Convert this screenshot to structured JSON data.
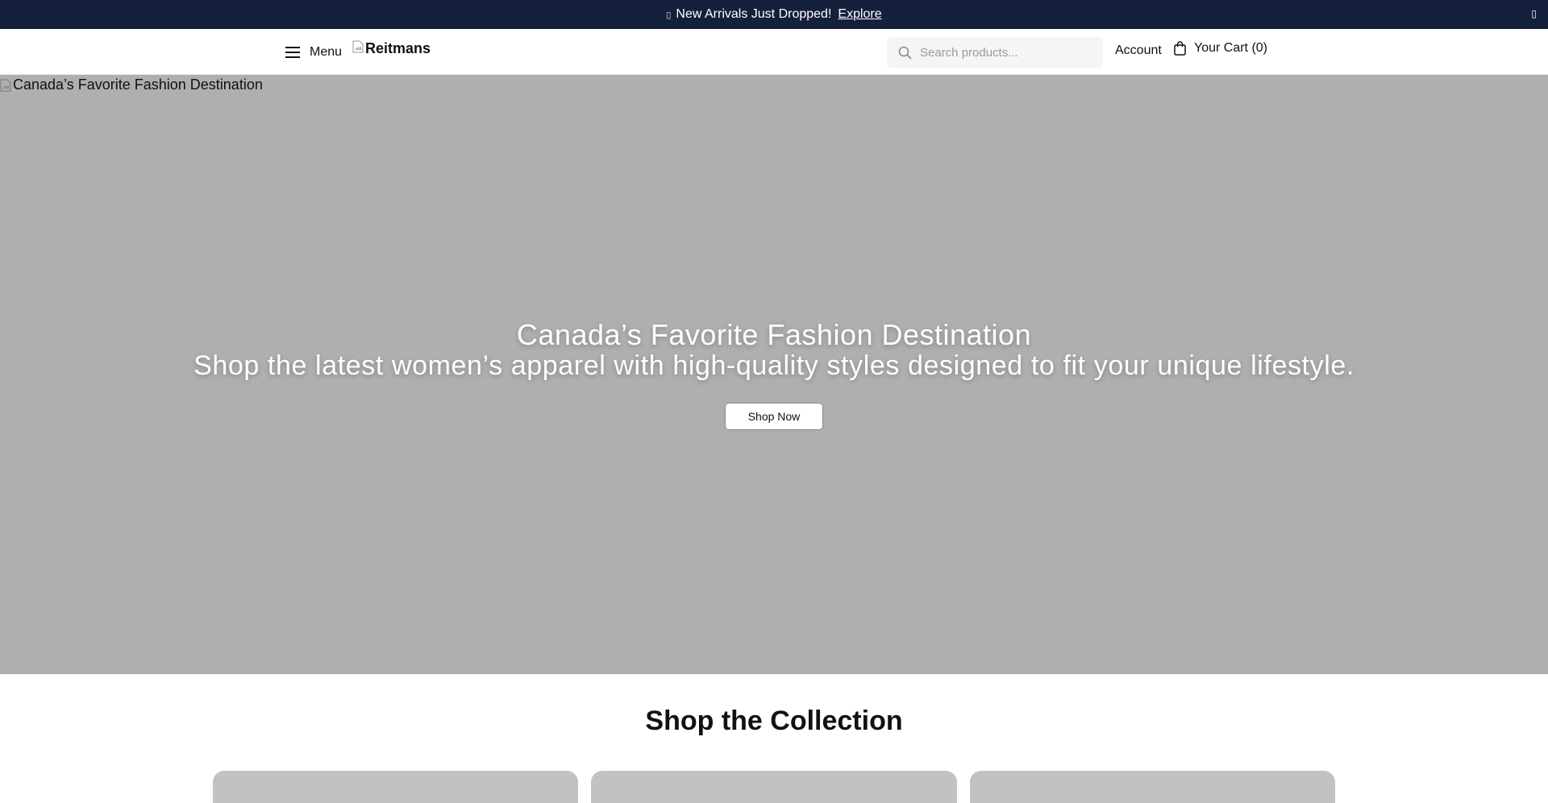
{
  "announcement": {
    "icon": "sparkle-icon",
    "text": "New Arrivals Just Dropped!",
    "link_label": "Explore",
    "close_icon": "close-icon"
  },
  "header": {
    "menu_label": "Menu",
    "logo_alt": "Reitmans",
    "search_placeholder": "Search products...",
    "account_label": "Account",
    "cart_label": "Your Cart (0)"
  },
  "hero": {
    "image_alt": "Canada’s Favorite Fashion Destination",
    "title": "Canada’s Favorite Fashion Destination",
    "subtitle": "Shop the latest women’s apparel with high-quality styles designed to fit your unique lifestyle.",
    "cta_label": "Shop Now",
    "background_color": "#afafaf"
  },
  "collection": {
    "title": "Shop the Collection",
    "card_color": "#c2c2c4"
  },
  "colors": {
    "announcement_bg": "#15203d",
    "text": "#111111"
  }
}
